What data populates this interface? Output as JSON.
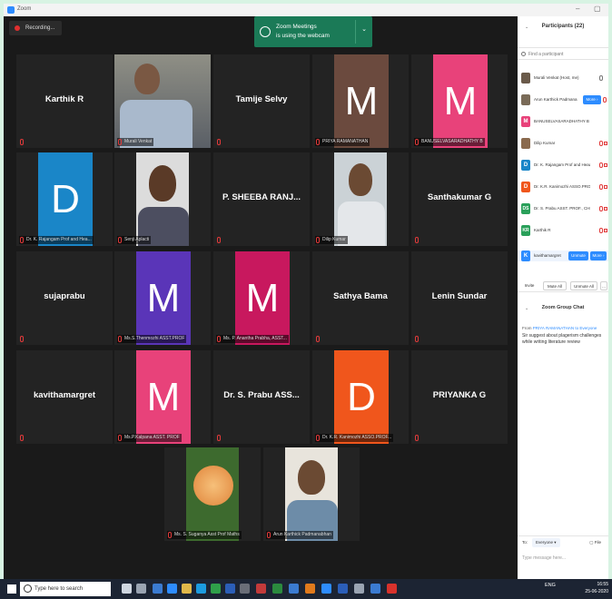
{
  "window": {
    "title": "Zoom",
    "minimize": "–",
    "maximize": "▢"
  },
  "recording": {
    "label": "Recording..."
  },
  "toast": {
    "line1": "Zoom Meetings",
    "line2": "is using the webcam",
    "dropdown": "⌄"
  },
  "tiles": [
    {
      "name": "Karthik R",
      "label": ""
    },
    {
      "name": "",
      "label": "Murali Venkat"
    },
    {
      "name": "Tamije Selvy",
      "label": ""
    },
    {
      "name": "",
      "letter": "M",
      "label": "PRIYA RAMANATHAN"
    },
    {
      "name": "",
      "letter": "M",
      "label": "BANUSELVASARADHATHY B"
    },
    {
      "name": "",
      "letter": "D",
      "label": "Dr. K. Rajangam Prof and Hea..."
    },
    {
      "name": "",
      "label": "Senji Aplacti"
    },
    {
      "name": "P. SHEEBA RANJ...",
      "label": ""
    },
    {
      "name": "",
      "label": "Dilip Kumar"
    },
    {
      "name": "Santhakumar G",
      "label": ""
    },
    {
      "name": "sujaprabu",
      "label": ""
    },
    {
      "name": "",
      "letter": "M",
      "label": "Ms.S.Thenmozhi ASST.PROF"
    },
    {
      "name": "",
      "letter": "M",
      "label": "Ms. P. Anantha Prabha, ASST..."
    },
    {
      "name": "Sathya Bama",
      "label": ""
    },
    {
      "name": "Lenin Sundar",
      "label": ""
    },
    {
      "name": "kavithamargret",
      "label": ""
    },
    {
      "name": "",
      "letter": "M",
      "label": "Ms.P.Kalpana ASST. PROF"
    },
    {
      "name": "Dr. S. Prabu ASS...",
      "label": ""
    },
    {
      "name": "",
      "letter": "D",
      "label": "Dr. K.R. Kanimozhi ASSO.PROF..."
    },
    {
      "name": "PRIYANKA G",
      "label": ""
    },
    {
      "name": "",
      "label": "Ms. S. Suganya Asst Prof Maths"
    },
    {
      "name": "",
      "label": "Arun Karthick Padmanabhan"
    }
  ],
  "participants": {
    "title": "Participants (22)",
    "collapse": "⌄",
    "search_placeholder": "Find a participant",
    "list": [
      {
        "name": "Murali Venkat (Host, me)",
        "avatar": ""
      },
      {
        "name": "Arun Karthick Padmana...",
        "avatar": "",
        "button": "More ›"
      },
      {
        "name": "BANUSELVASARADHATHY B",
        "avatar": "M"
      },
      {
        "name": "Dilip Kumar",
        "avatar": ""
      },
      {
        "name": "Dr. K. Rajangam Prof and Head...",
        "avatar": "D"
      },
      {
        "name": "Dr. K.R. Kanimozhi ASSO.PROF ...",
        "avatar": "D"
      },
      {
        "name": "Dr. S. Prabu ASST. PROF., CHEM...",
        "avatar": "DS"
      },
      {
        "name": "Karthik R",
        "avatar": "KR"
      },
      {
        "name": "kavithamargret",
        "avatar": "K",
        "button": "Unmute",
        "button2": "More ›"
      }
    ],
    "invite": "Invite",
    "mute_all": "Mute All",
    "unmute_all": "Unmute All",
    "more": "..."
  },
  "chat": {
    "title": "Zoom Group Chat",
    "from_prefix": "From",
    "from_name": "PRIYA RAMANATHAN",
    "to_suffix": "to Everyone",
    "message": "Sir suggest about plagerism challenges while writing literature review",
    "to_label": "To:",
    "to_value": "Everyone ▾",
    "file_label": "File",
    "input_placeholder": "Type message here..."
  },
  "taskbar": {
    "search_placeholder": "Type here to search",
    "lang": "ENG",
    "time": "16:55",
    "date": "25-06-2020"
  },
  "colors": {
    "avatar_brown": "#6b4a3e",
    "avatar_pink": "#e8427a",
    "avatar_blue": "#1a86c8",
    "avatar_purple": "#5a35b8",
    "avatar_magenta": "#c8185e",
    "avatar_orange": "#f0561c",
    "toast_green": "#1b7a57",
    "zoom_blue": "#2d8cff"
  }
}
